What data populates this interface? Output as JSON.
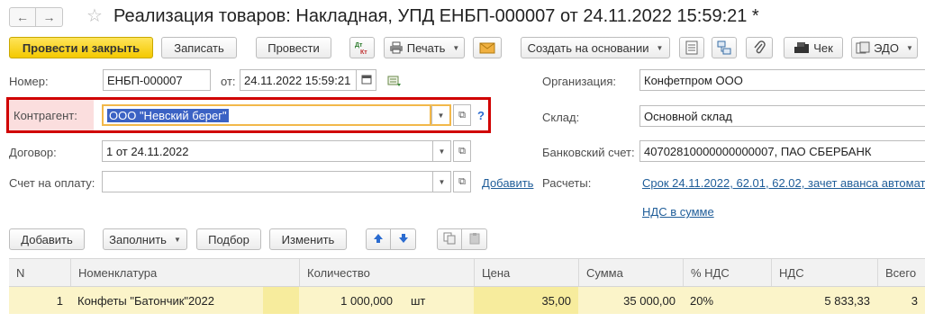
{
  "window": {
    "title": "Реализация товаров: Накладная, УПД ЕНБП-000007 от 24.11.2022 15:59:21 *"
  },
  "toolbar": {
    "post_close": "Провести и закрыть",
    "save": "Записать",
    "post": "Провести",
    "print": "Печать",
    "create_based": "Создать на основании",
    "check": "Чек",
    "edo": "ЭДО"
  },
  "form": {
    "number_label": "Номер:",
    "number_value": "ЕНБП-000007",
    "from_label": "от:",
    "date_value": "24.11.2022 15:59:21",
    "contractor_label": "Контрагент:",
    "contractor_value": "ООО \"Невский берег\"",
    "help": "?",
    "contract_label": "Договор:",
    "contract_value": "1 от 24.11.2022",
    "invoice_label": "Счет на оплату:",
    "invoice_value": "",
    "add_link": "Добавить",
    "org_label": "Организация:",
    "org_value": "Конфетпром ООО",
    "warehouse_label": "Склад:",
    "warehouse_value": "Основной склад",
    "bank_label": "Банковский счет:",
    "bank_value": "40702810000000000007, ПАО СБЕРБАНК",
    "settlements_label": "Расчеты:",
    "settlements_link": "Срок 24.11.2022, 62.01, 62.02, зачет аванса автомат",
    "vat_link": "НДС в сумме"
  },
  "table_toolbar": {
    "add": "Добавить",
    "fill": "Заполнить",
    "pick": "Подбор",
    "change": "Изменить"
  },
  "table": {
    "headers": {
      "n": "N",
      "item": "Номенклатура",
      "qty": "Количество",
      "price": "Цена",
      "sum": "Сумма",
      "vat_rate": "% НДС",
      "vat": "НДС",
      "total": "Всего"
    },
    "rows": [
      {
        "n": "1",
        "item": "Конфеты \"Батончик\"2022",
        "qty": "1 000,000",
        "unit": "шт",
        "price": "35,00",
        "sum": "35 000,00",
        "vat_rate": "20%",
        "vat": "5 833,33",
        "total": "3"
      }
    ]
  },
  "colors": {
    "accent_yellow": "#f4c900",
    "highlight_red": "#d00000",
    "row_yellow": "#fbf4c9",
    "link_blue": "#1f5d99"
  }
}
